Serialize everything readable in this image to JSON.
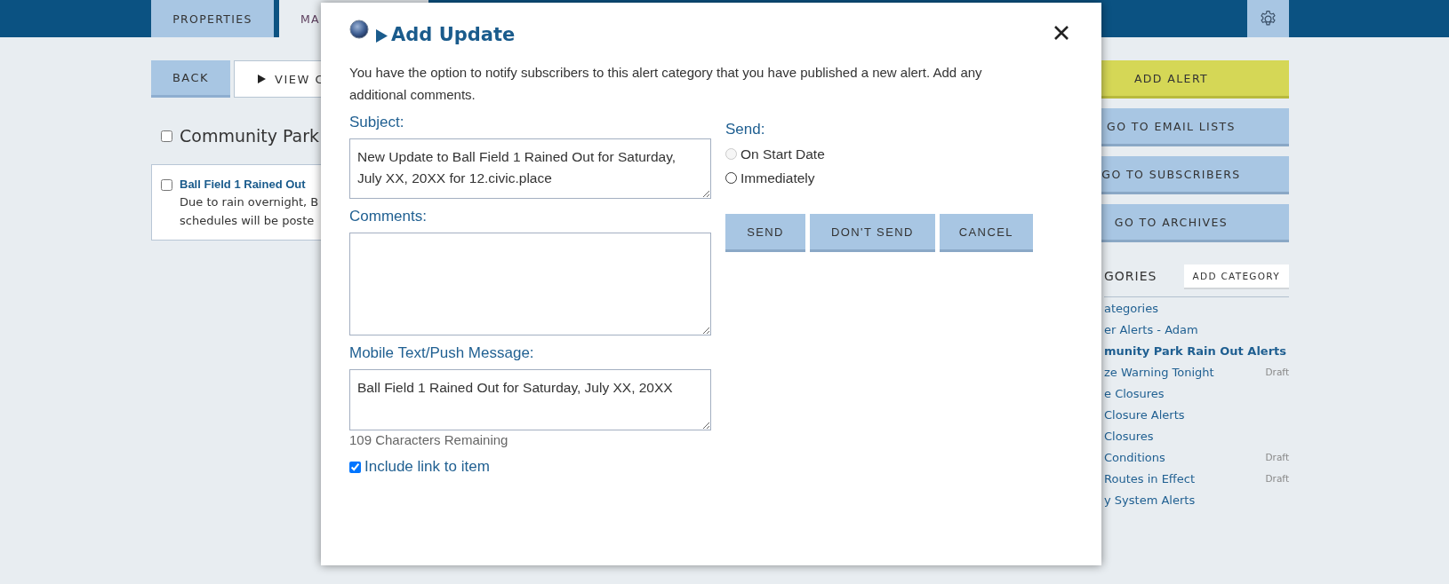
{
  "top_nav": {
    "tabs": [
      {
        "label": "PROPERTIES",
        "selected": false
      },
      {
        "label": "MA",
        "selected": true
      }
    ]
  },
  "toolbar": {
    "buttons": [
      {
        "label": "BACK",
        "kind": "plain"
      },
      {
        "label": "VIEW C",
        "kind": "outline"
      }
    ]
  },
  "category_heading": {
    "label": "Community Park",
    "checked": false
  },
  "alerts": [
    {
      "title": "Ball Field 1 Rained Out",
      "lines": [
        "Due to rain overnight, B",
        "schedules will be poste"
      ],
      "checked": false
    }
  ],
  "actions": [
    {
      "label": "ADD ALERT",
      "kind": "primary"
    },
    {
      "label": "GO TO EMAIL LISTS",
      "kind": "secondary"
    },
    {
      "label": "GO TO SUBSCRIBERS",
      "kind": "secondary"
    },
    {
      "label": "GO TO ARCHIVES",
      "kind": "secondary"
    }
  ],
  "categories": {
    "heading": "GORIES",
    "add_button": "ADD CATEGORY",
    "items": [
      {
        "label": "ategories",
        "selected": false
      },
      {
        "label": "er Alerts - Adam",
        "selected": false
      },
      {
        "label": "munity Park Rain Out Alerts",
        "selected": true
      },
      {
        "label": "ze Warning Tonight",
        "selected": false,
        "badge": "Draft"
      },
      {
        "label": "e Closures",
        "selected": false
      },
      {
        "label": "Closure Alerts",
        "selected": false
      },
      {
        "label": "Closures",
        "selected": false
      },
      {
        "label": "Conditions",
        "selected": false,
        "badge": "Draft"
      },
      {
        "label": "Routes in Effect",
        "selected": false,
        "badge": "Draft"
      },
      {
        "label": "y System Alerts",
        "selected": false
      }
    ]
  },
  "dialog": {
    "title": "Add Update",
    "description": "You have the option to notify subscribers to this alert category that you have published a new alert. Add any additional comments.",
    "fields": [
      {
        "label": "Subject:",
        "value": "New Update to Ball Field 1 Rained Out for Saturday, July XX, 20XX for 12.civic.place"
      },
      {
        "label": "Comments:"
      },
      {
        "label": "Mobile Text/Push Message:",
        "value": "Ball Field 1 Rained Out for Saturday, July XX, 20XX",
        "counter": "109 Characters Remaining"
      }
    ],
    "include_link": {
      "label": "Include link to item",
      "checked": true
    },
    "send": {
      "label": "Send:",
      "options": [
        {
          "label": "On Start Date",
          "selected": false,
          "disabled": true
        },
        {
          "label": "Immediately",
          "selected": false,
          "disabled": false
        }
      ]
    },
    "buttons": [
      "SEND",
      "DON'T SEND",
      "CANCEL"
    ]
  }
}
